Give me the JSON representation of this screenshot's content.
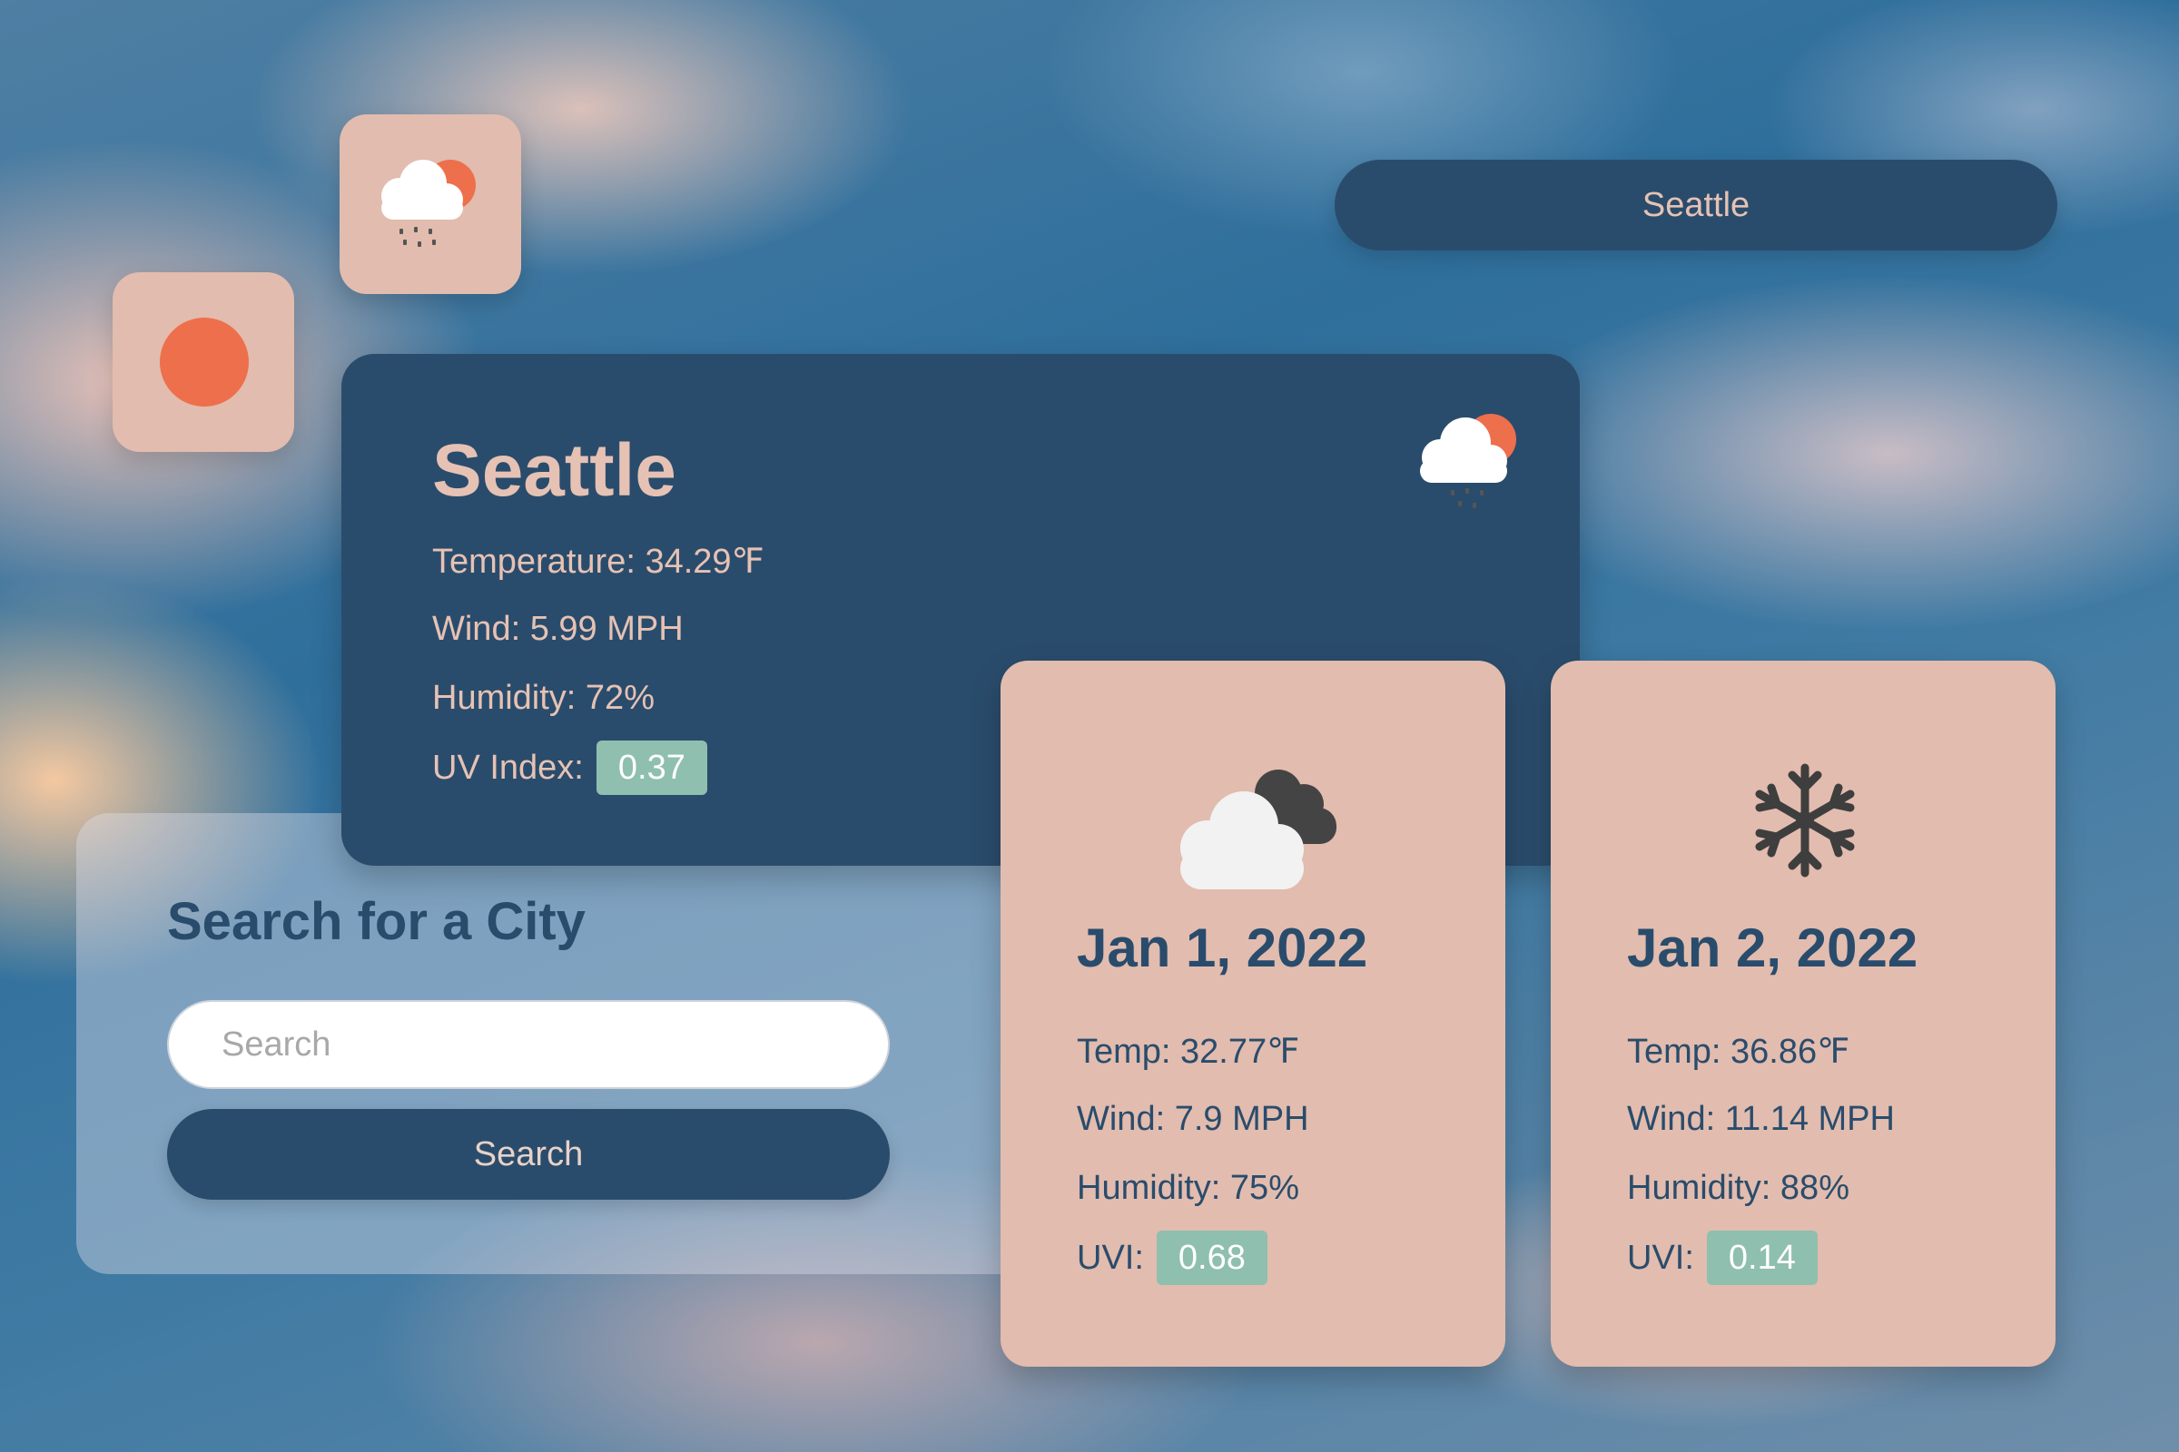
{
  "search": {
    "title": "Search for a City",
    "placeholder": "Search",
    "button_label": "Search"
  },
  "top_city_button": "Seattle",
  "current": {
    "city": "Seattle",
    "temperature": "Temperature: 34.29℉",
    "wind": "Wind: 5.99 MPH",
    "humidity": "Humidity: 72%",
    "uv_label": "UV Index:",
    "uv_value": "0.37",
    "icon": "rain-cloud-sun-icon"
  },
  "forecast": [
    {
      "date": "Jan 1, 2022",
      "temp": "Temp: 32.77℉",
      "wind": "Wind: 7.9 MPH",
      "humidity": "Humidity: 75%",
      "uv_label": "UVI:",
      "uv_value": "0.68",
      "icon": "cloudy-icon"
    },
    {
      "date": "Jan 2, 2022",
      "temp": "Temp: 36.86℉",
      "wind": "Wind: 11.14 MPH",
      "humidity": "Humidity: 88%",
      "uv_label": "UVI:",
      "uv_value": "0.14",
      "icon": "snowflake-icon"
    }
  ],
  "tiles": [
    {
      "icon": "rain-cloud-sun-icon"
    },
    {
      "icon": "sun-icon"
    }
  ],
  "colors": {
    "navy": "#2a4c6c",
    "peach": "#e2bcae",
    "sun": "#ee6f4c",
    "uv_badge": "#8fbfae"
  }
}
